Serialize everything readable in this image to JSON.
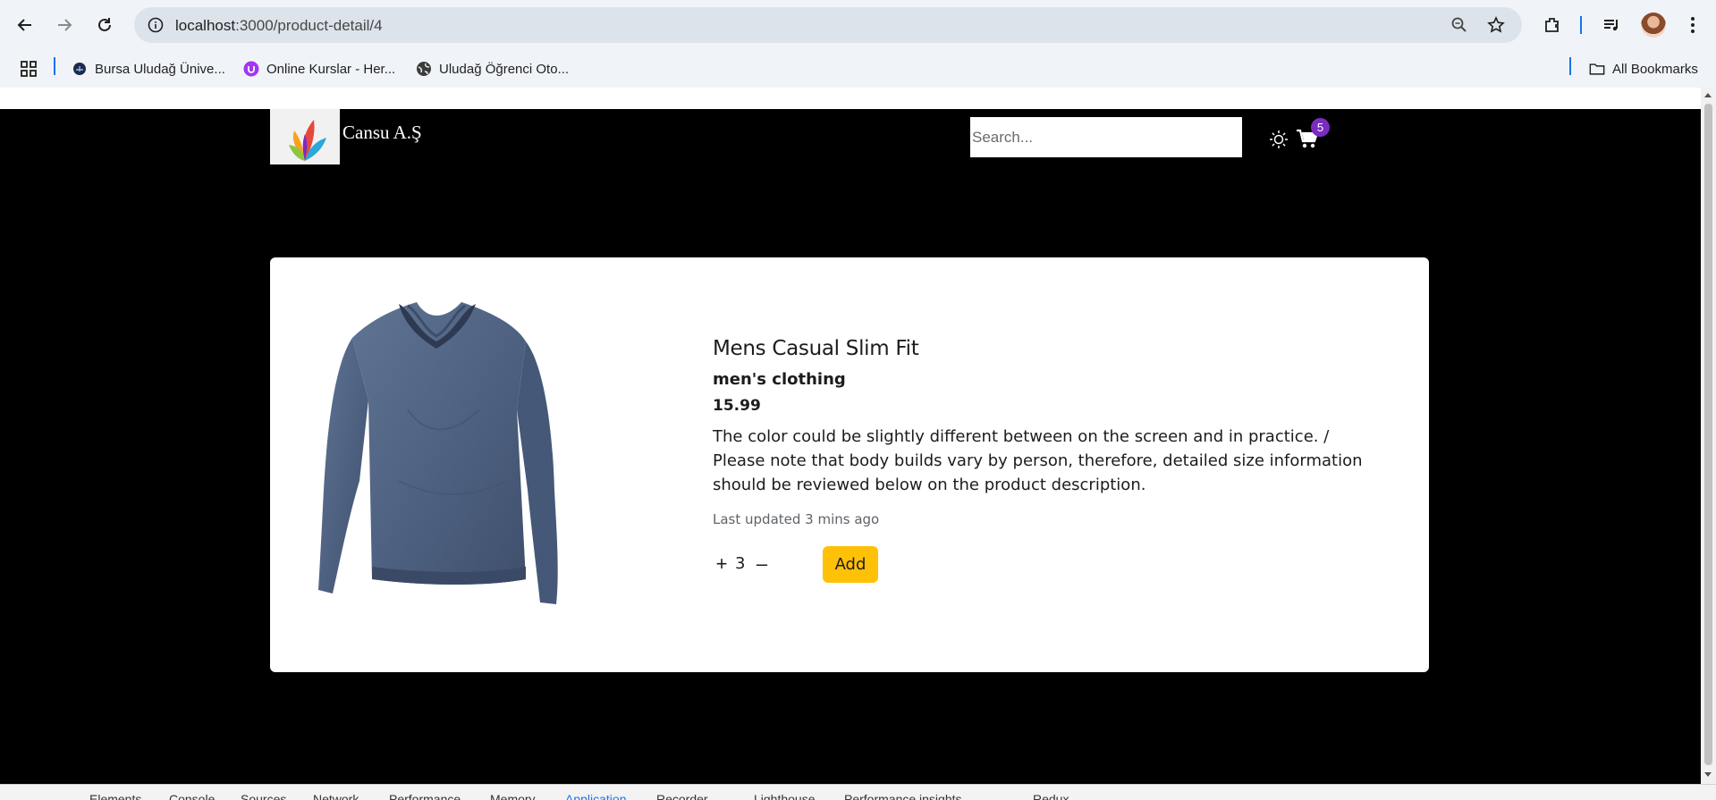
{
  "browser": {
    "url_host": "localhost",
    "url_path": ":3000/product-detail/4",
    "bookmarks": [
      {
        "label": "Bursa Uludağ Ünive...",
        "icon": "globe-dark-icon"
      },
      {
        "label": "Online Kurslar - Her...",
        "icon": "udemy-icon"
      },
      {
        "label": "Uludağ Öğrenci Oto...",
        "icon": "globe-icon"
      }
    ],
    "all_bookmarks": "All Bookmarks"
  },
  "site": {
    "brand": "Cansu A.Ş",
    "search_placeholder": "Search...",
    "cart_count": "5"
  },
  "product": {
    "title": "Mens Casual Slim Fit",
    "category": "men's clothing",
    "price": "15.99",
    "description": "The color could be slightly different between on the screen and in practice. / Please note that body builds vary by person, therefore, detailed size information should be reviewed below on the product description.",
    "updated": "Last updated 3 mins ago",
    "plus": "+",
    "quantity": "3",
    "minus": "–",
    "add_label": "Add"
  },
  "devtools": {
    "tabs": [
      "Elements",
      "Console",
      "Sources",
      "Network",
      "Performance",
      "Memory",
      "Application",
      "Recorder",
      "Lighthouse",
      "Performance insights",
      "Redux"
    ],
    "active_tab": "Application"
  },
  "colors": {
    "page_bg": "#000000",
    "card_bg": "#ffffff",
    "add_button": "#ffc107",
    "badge": "#7b2cbf"
  }
}
